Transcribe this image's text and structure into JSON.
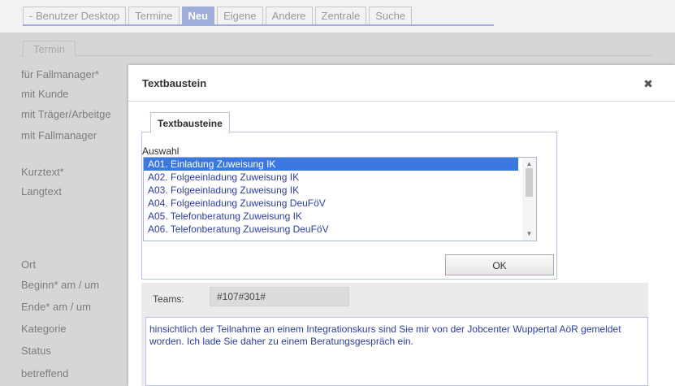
{
  "top_tabs": [
    "- Benutzer Desktop",
    "Termine",
    "Neu",
    "Eigene",
    "Andere",
    "Zentrale",
    "Suche"
  ],
  "active_tab_index": 2,
  "background_form": {
    "tab_label": "Termin",
    "labels": [
      "für Fallmanager*",
      "mit Kunde",
      "mit Träger/Arbeitge",
      "mit Fallmanager",
      "Kurztext*",
      "Langtext",
      "Ort",
      "Beginn* am / um",
      "Ende* am / um",
      "Kategorie",
      "Status",
      "betreffend"
    ]
  },
  "dialog": {
    "title": "Textbaustein",
    "close_symbol": "✖",
    "tab_label": "Textbausteine",
    "auswahl_label": "Auswahl",
    "list_items": [
      "A01. Einladung Zuweisung IK",
      "A02. Folgeeinladung Zuweisung IK",
      "A03. Folgeeinladung Zuweisung IK",
      "A04. Folgeeinladung Zuweisung DeuFöV",
      "A05. Telefonberatung Zuweisung IK",
      "A06. Telefonberatung Zuweisung DeuFöV"
    ],
    "selected_index": 0,
    "ok_label": "OK",
    "teams_label": "Teams:",
    "teams_value": "#107#301#",
    "preview_text": "hinsichtlich der Teilnahme an einem Integrationskurs sind Sie mir von der Jobcenter Wuppertal AöR gemeldet worden. Ich lade Sie daher zu einem Beratungsgespräch ein."
  },
  "colors": {
    "active_tab": "#9faed8",
    "selection": "#3b78e0",
    "list_text": "#2d3e9c"
  }
}
